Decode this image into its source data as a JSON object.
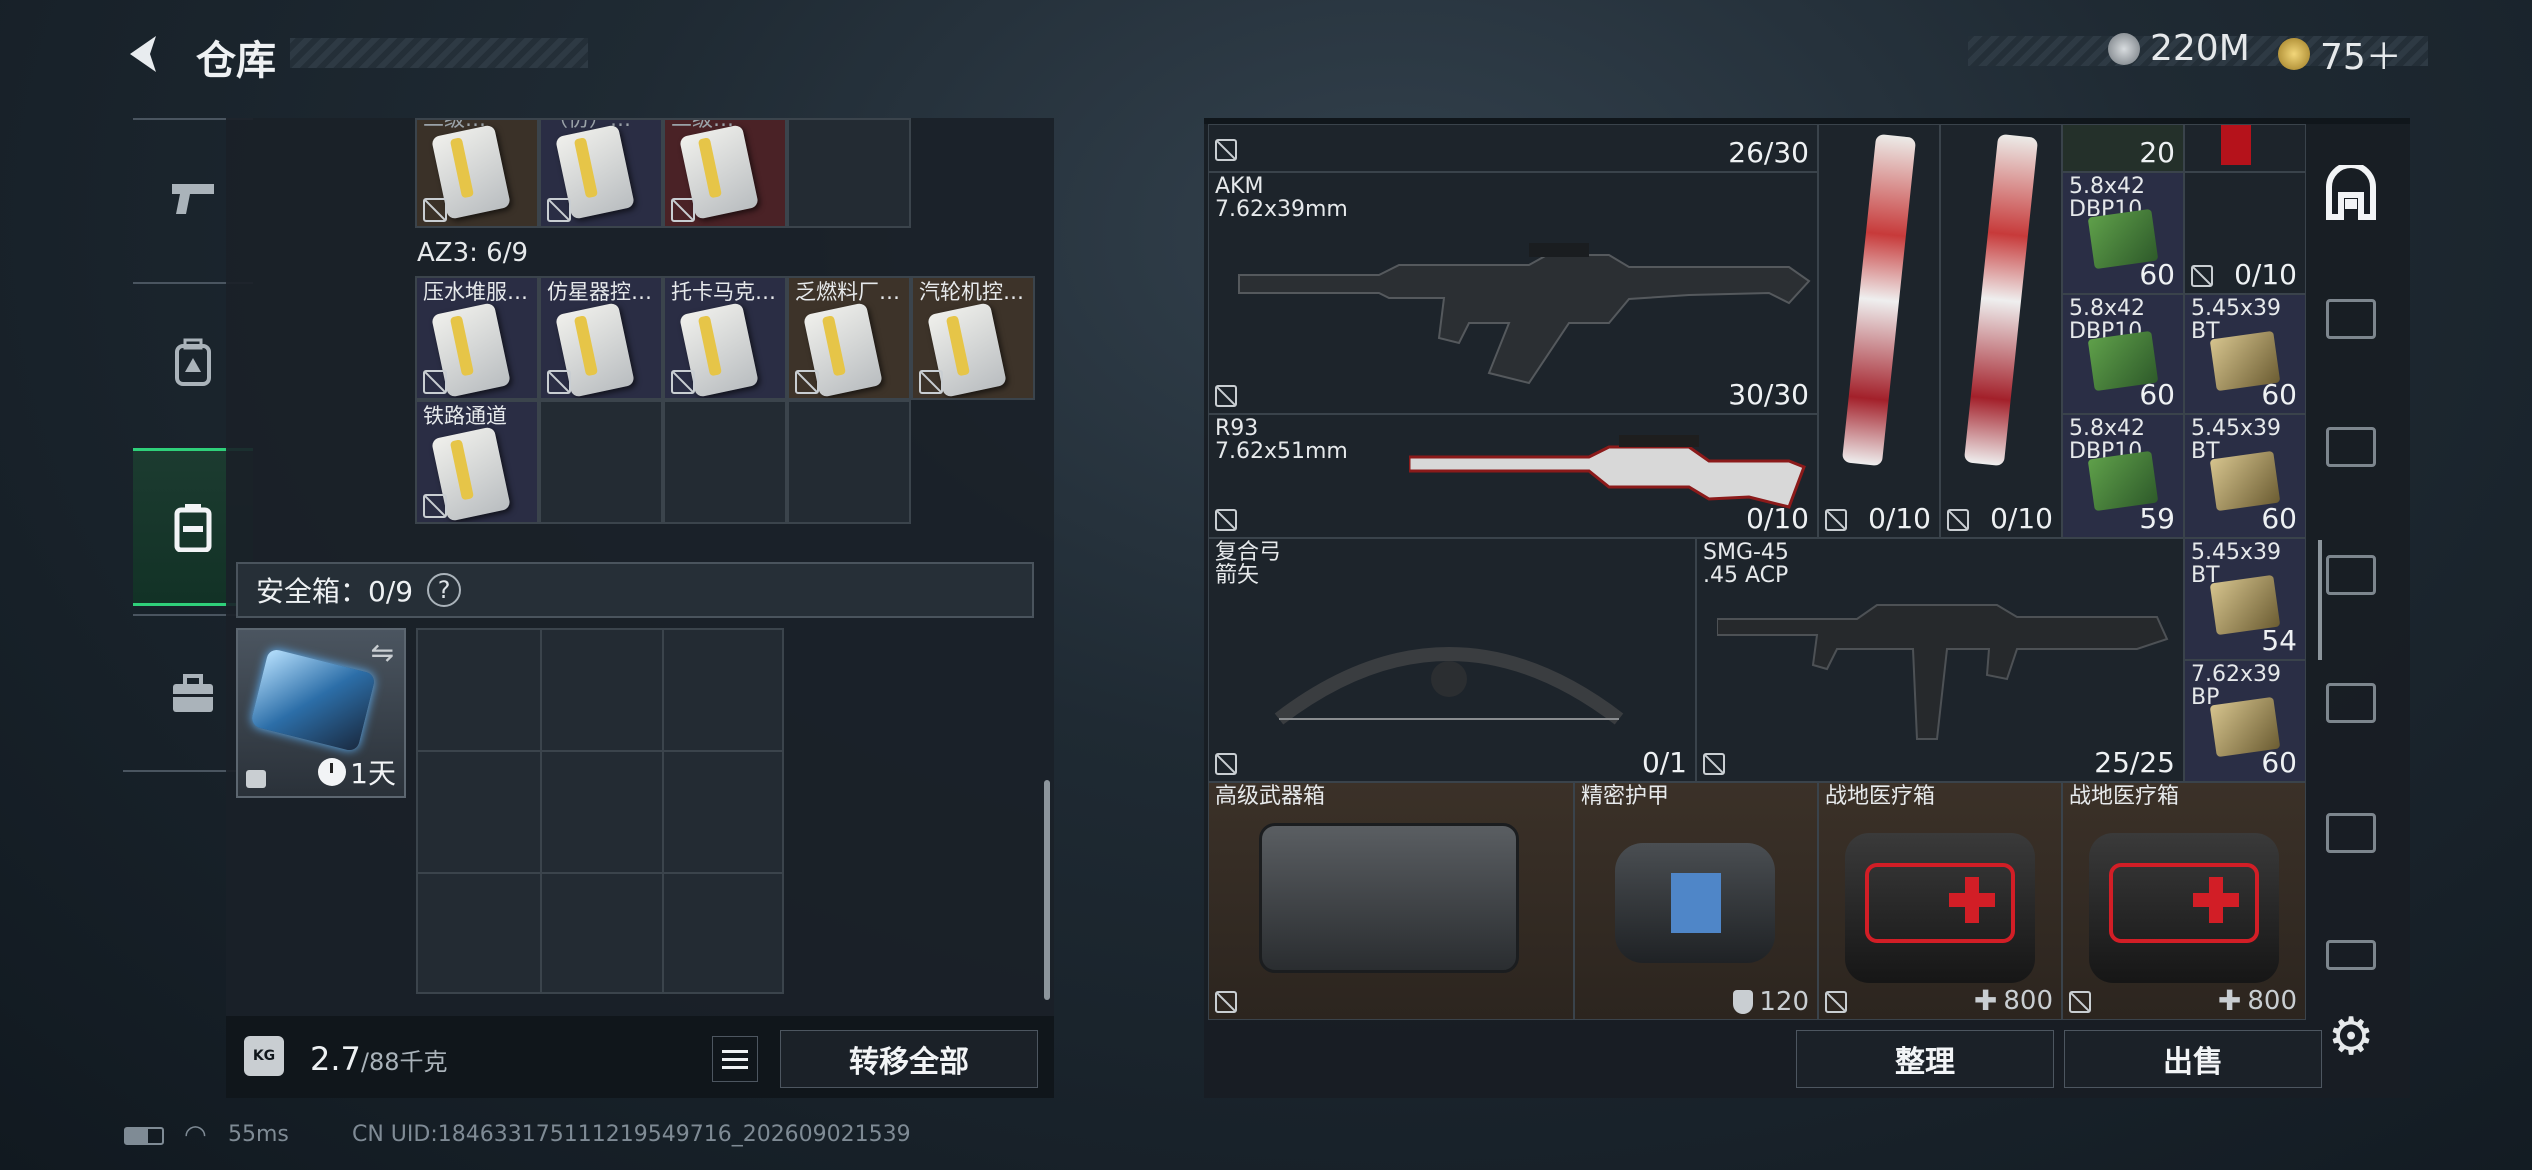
{
  "header": {
    "title": "仓库",
    "currency1": "220M",
    "currency2": "75＋"
  },
  "left": {
    "az3_label": "AZ3: 6/9",
    "top_row": [
      {
        "name": "二级…"
      },
      {
        "name": "（仿）…"
      },
      {
        "name": "二级…"
      }
    ],
    "cards": [
      {
        "name": "压水堆服…"
      },
      {
        "name": "仿星器控…"
      },
      {
        "name": "托卡马克…"
      },
      {
        "name": "乏燃料厂…"
      },
      {
        "name": "汽轮机控…"
      },
      {
        "name": "铁路通道"
      }
    ],
    "safebox_label": "安全箱：0/9",
    "safebox_help": "?",
    "safebox_timer": "1天",
    "weight_value": "2.7",
    "weight_total": "/88千克",
    "transfer_all": "转移全部"
  },
  "right": {
    "top_count1": "26/30",
    "top_count2": "20",
    "top_count3": "0/10",
    "akm": {
      "name": "AKM",
      "caliber": "7.62x39mm",
      "count": "30/30"
    },
    "r93": {
      "name": "R93",
      "caliber": "7.62x51mm",
      "count": "0/10"
    },
    "skin1_count": "0/10",
    "skin2_count": "0/10",
    "bow": {
      "name": "复合弓",
      "sub": "箭矢",
      "count": "0/1"
    },
    "smg": {
      "name": "SMG-45",
      "caliber": ".45 ACP",
      "count": "25/25"
    },
    "ammo": [
      {
        "name": "5.8x42\nDBP10",
        "count": "60"
      },
      {
        "name": "5.8x42\nDBP10",
        "count": "60"
      },
      {
        "name": "5.45x39\nBT",
        "count": "60"
      },
      {
        "name": "5.8x42\nDBP10",
        "count": "59"
      },
      {
        "name": "5.45x39\nBT",
        "count": "60"
      },
      {
        "name": "5.45x39\nBT",
        "count": "54"
      },
      {
        "name": "7.62x39\nBP",
        "count": "60"
      }
    ],
    "gear": [
      {
        "name": "高级武器箱",
        "count": ""
      },
      {
        "name": "精密护甲",
        "count": "120"
      },
      {
        "name": "战地医疗箱",
        "count": "800"
      },
      {
        "name": "战地医疗箱",
        "count": "800"
      }
    ],
    "sort_button": "整理",
    "sell_button": "出售"
  },
  "status": {
    "ping": "55ms",
    "uid": "CN UID:18463317511121954971​6_202609021539"
  },
  "colors": {
    "accent_green": "#2fd07a",
    "gold_bg": "#3b3128",
    "ammo_bg": "#2a2e45"
  }
}
